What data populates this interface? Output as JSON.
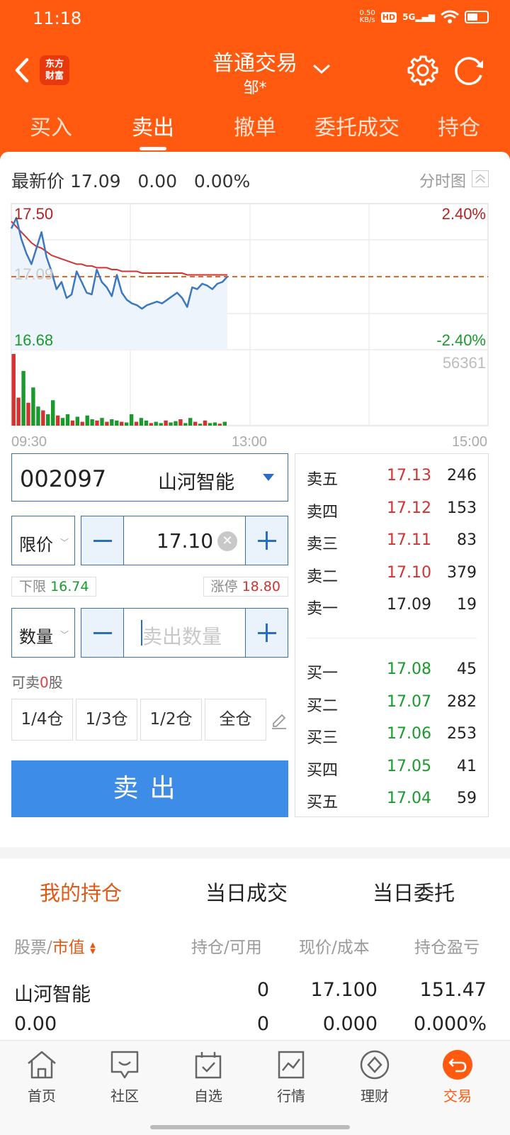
{
  "status_bar": {
    "time": "11:18",
    "net_speed_value": "0.50",
    "net_speed_unit": "KB/s",
    "hd": "HD",
    "signal": "5G"
  },
  "header": {
    "logo_line1": "东方",
    "logo_line2": "财富",
    "title": "普通交易",
    "subtitle": "邹*"
  },
  "tabs": [
    {
      "label": "买入",
      "active": false
    },
    {
      "label": "卖出",
      "active": true
    },
    {
      "label": "撤单",
      "active": false
    },
    {
      "label": "委托成交",
      "active": false
    },
    {
      "label": "持仓",
      "active": false
    }
  ],
  "quote": {
    "text": "最新价 17.09   0.00   0.00%",
    "view_label": "分时图"
  },
  "chart_data": {
    "type": "line",
    "prev_close": 17.09,
    "y_high_label": "17.50",
    "y_low_label": "16.68",
    "y_mid_label": "17.09",
    "pct_high_label": "2.40%",
    "pct_low_label": "-2.40%",
    "volume_label": "56361",
    "x_labels": [
      "09:30",
      "13:00",
      "15:00"
    ],
    "ylim": [
      16.68,
      17.5
    ],
    "price": [
      17.36,
      17.42,
      17.3,
      17.22,
      17.16,
      17.25,
      17.34,
      17.2,
      17.12,
      17.02,
      17.06,
      16.97,
      16.99,
      17.12,
      17.06,
      17.0,
      16.99,
      17.13,
      17.06,
      17.03,
      16.98,
      17.1,
      17.0,
      16.96,
      16.94,
      16.93,
      16.91,
      16.93,
      16.94,
      16.95,
      16.94,
      16.96,
      16.98,
      17.0,
      16.97,
      16.92,
      17.03,
      17.02,
      17.05,
      17.04,
      17.02,
      17.05,
      17.06,
      17.09
    ],
    "avg": [
      17.4,
      17.37,
      17.34,
      17.31,
      17.28,
      17.26,
      17.25,
      17.23,
      17.21,
      17.2,
      17.19,
      17.18,
      17.17,
      17.16,
      17.16,
      17.15,
      17.15,
      17.14,
      17.14,
      17.14,
      17.13,
      17.13,
      17.12,
      17.12,
      17.12,
      17.12,
      17.11,
      17.11,
      17.11,
      17.11,
      17.11,
      17.11,
      17.11,
      17.11,
      17.11,
      17.1,
      17.1,
      17.1,
      17.1,
      17.1,
      17.1,
      17.1,
      17.1,
      17.1
    ],
    "volume": [
      56361,
      22000,
      43000,
      18000,
      30000,
      15000,
      12000,
      9000,
      20000,
      8000,
      6000,
      9000,
      4000,
      7000,
      3000,
      8000,
      5000,
      4000,
      6000,
      3000,
      5000,
      4000,
      3000,
      2500,
      9000,
      3000,
      6000,
      4000,
      2000,
      3000,
      2000,
      4000,
      2500,
      3500,
      5000,
      2000,
      6000,
      3000,
      1500,
      4000,
      2000,
      2500,
      1500,
      3000
    ],
    "volume_colors": [
      "red",
      "red",
      "green",
      "red",
      "green",
      "green",
      "red",
      "green",
      "green",
      "red",
      "green",
      "green",
      "red",
      "green",
      "red",
      "green",
      "green",
      "red",
      "green",
      "red",
      "green",
      "green",
      "red",
      "green",
      "green",
      "red",
      "green",
      "green",
      "red",
      "green",
      "green",
      "red",
      "green",
      "green",
      "red",
      "green",
      "green",
      "red",
      "green",
      "red",
      "green",
      "green",
      "red",
      "green"
    ]
  },
  "order": {
    "code": "002097",
    "name": "山河智能",
    "price_type": "限价",
    "price": "17.10",
    "lower_limit_label": "下限",
    "lower_limit_value": "16.74",
    "upper_limit_label": "涨停",
    "upper_limit_value": "18.80",
    "qty_type": "数量",
    "qty_placeholder": "卖出数量",
    "avail_prefix": "可卖",
    "avail_count": "0",
    "avail_suffix": "股",
    "ratios": [
      "1/4仓",
      "1/3仓",
      "1/2仓",
      "全仓"
    ],
    "sell_label": "卖出"
  },
  "book": {
    "asks": [
      {
        "label": "卖五",
        "price": "17.13",
        "vol": "246",
        "color": "red"
      },
      {
        "label": "卖四",
        "price": "17.12",
        "vol": "153",
        "color": "red"
      },
      {
        "label": "卖三",
        "price": "17.11",
        "vol": "83",
        "color": "red"
      },
      {
        "label": "卖二",
        "price": "17.10",
        "vol": "379",
        "color": "red"
      },
      {
        "label": "卖一",
        "price": "17.09",
        "vol": "19",
        "color": "black"
      }
    ],
    "bids": [
      {
        "label": "买一",
        "price": "17.08",
        "vol": "45",
        "color": "green"
      },
      {
        "label": "买二",
        "price": "17.07",
        "vol": "282",
        "color": "green"
      },
      {
        "label": "买三",
        "price": "17.06",
        "vol": "253",
        "color": "green"
      },
      {
        "label": "买四",
        "price": "17.05",
        "vol": "41",
        "color": "green"
      },
      {
        "label": "买五",
        "price": "17.04",
        "vol": "59",
        "color": "green"
      }
    ]
  },
  "positions": {
    "tabs": [
      "我的持仓",
      "当日成交",
      "当日委托"
    ],
    "headers": {
      "stock": "股票/",
      "value": "市值",
      "hold": "持仓/可用",
      "price": "现价/成本",
      "pnl": "持仓盈亏"
    },
    "rows": [
      {
        "name": "山河智能",
        "value": "0.00",
        "hold": "0",
        "avail": "0",
        "price": "17.100",
        "cost": "0.000",
        "pnl": "151.47",
        "pnl_pct": "0.000%"
      }
    ]
  },
  "bottom_nav": [
    {
      "label": "首页",
      "icon": "home-icon"
    },
    {
      "label": "社区",
      "icon": "community-icon"
    },
    {
      "label": "自选",
      "icon": "watchlist-icon"
    },
    {
      "label": "行情",
      "icon": "market-icon"
    },
    {
      "label": "理财",
      "icon": "wealth-icon"
    },
    {
      "label": "交易",
      "icon": "trade-icon",
      "active": true
    }
  ]
}
